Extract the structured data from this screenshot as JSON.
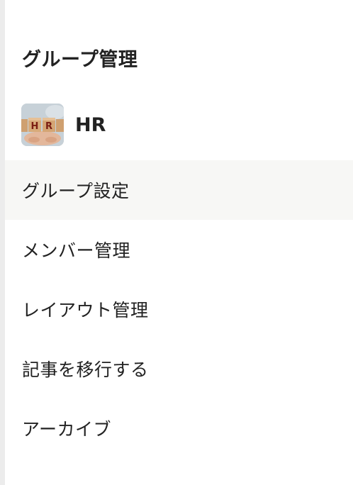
{
  "section": {
    "title": "グループ管理"
  },
  "group": {
    "name": "HR",
    "avatar_text": "H R"
  },
  "menu": {
    "items": [
      {
        "label": "グループ設定",
        "active": true
      },
      {
        "label": "メンバー管理",
        "active": false
      },
      {
        "label": "レイアウト管理",
        "active": false
      },
      {
        "label": "記事を移行する",
        "active": false
      },
      {
        "label": "アーカイブ",
        "active": false
      }
    ]
  },
  "colors": {
    "active_background": "#f7f7f5",
    "text": "#222222",
    "rail": "#ececec"
  }
}
